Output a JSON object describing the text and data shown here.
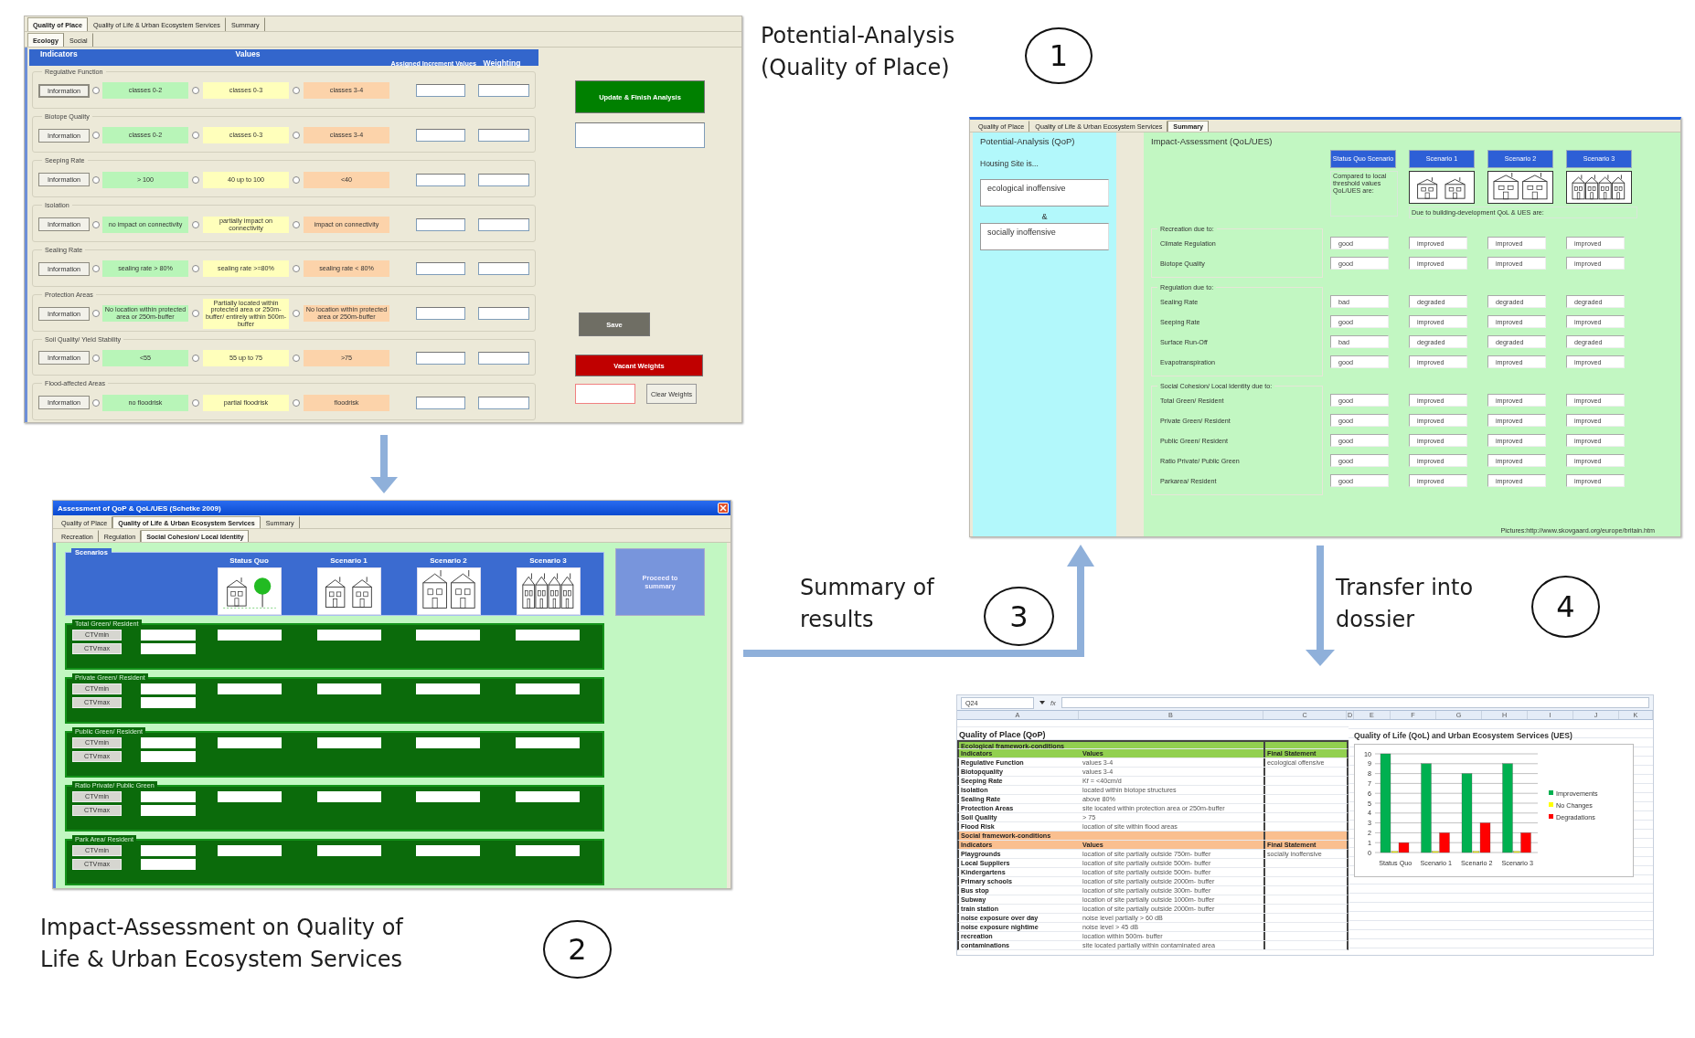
{
  "step_1": {
    "number": "1",
    "caption": [
      "Potential-Analysis",
      "(Quality of Place)"
    ]
  },
  "quality_of_place_window": {
    "tabs": [
      {
        "label": "Quality of Place",
        "selected": true
      },
      {
        "label": "Quality of Life & Urban Ecosystem Services",
        "selected": false
      },
      {
        "label": "Summary",
        "selected": false
      }
    ],
    "subtabs": [
      {
        "label": "Ecology",
        "selected": true
      },
      {
        "label": "Social",
        "selected": false
      }
    ],
    "columns": [
      "Indicators",
      "Values",
      "Assigned Increment Values",
      "Weighting"
    ],
    "indicators": [
      {
        "name": "Regulative Function",
        "button": "Information",
        "options": [
          {
            "text": "classes 0-2",
            "color": "#b8f5b8",
            "selected": false
          },
          {
            "text": "classes 0-3",
            "color": "#ffffbb",
            "selected": false
          },
          {
            "text": "classes 3-4",
            "color": "#fcd3aa",
            "selected": false
          }
        ]
      },
      {
        "name": "Biotope Quality",
        "button": "Information",
        "options": [
          {
            "text": "classes 0-2",
            "color": "#b8f5b8",
            "selected": false
          },
          {
            "text": "classes 0-3",
            "color": "#ffffbb",
            "selected": false
          },
          {
            "text": "classes 3-4",
            "color": "#fcd3aa",
            "selected": false
          }
        ]
      },
      {
        "name": "Seeping Rate",
        "button": "Information",
        "options": [
          {
            "text": "> 100",
            "color": "#b8f5b8",
            "selected": false
          },
          {
            "text": "40 up to 100",
            "color": "#ffffbb",
            "selected": false
          },
          {
            "text": "<40",
            "color": "#fcd3aa",
            "selected": false
          }
        ]
      },
      {
        "name": "Isolation",
        "button": "Information",
        "options": [
          {
            "text": "no impact on connectivity",
            "color": "#b8f5b8",
            "selected": false
          },
          {
            "text": "partially impact on connectivity",
            "color": "#ffffbb",
            "selected": false
          },
          {
            "text": "impact on connectivity",
            "color": "#fcd3aa",
            "selected": false
          }
        ]
      },
      {
        "name": "Sealing Rate",
        "button": "Information",
        "options": [
          {
            "text": "sealing rate > 80%",
            "color": "#b8f5b8",
            "selected": false
          },
          {
            "text": "sealing rate >=80%",
            "color": "#ffffbb",
            "selected": false
          },
          {
            "text": "sealing rate < 80%",
            "color": "#fcd3aa",
            "selected": false
          }
        ]
      },
      {
        "name": "Protection Areas",
        "button": "Information",
        "options": [
          {
            "text": "No location within protected area or 250m-buffer",
            "color": "#b8f5b8",
            "selected": false
          },
          {
            "text": "Partially located within protected area or 250m-buffer/ entirely within 500m-buffer",
            "color": "#ffffbb",
            "selected": false
          },
          {
            "text": "No location within protected area or 250m-buffer",
            "color": "#fcd3aa",
            "selected": false
          }
        ]
      },
      {
        "name": "Soil Quality/ Yield Stability",
        "button": "Information",
        "options": [
          {
            "text": "<55",
            "color": "#b8f5b8",
            "selected": false
          },
          {
            "text": "55 up to 75",
            "color": "#ffffbb",
            "selected": false
          },
          {
            "text": ">75",
            "color": "#fcd3aa",
            "selected": false
          }
        ]
      },
      {
        "name": "Flood-affected Areas",
        "button": "Information",
        "options": [
          {
            "text": "no floodrisk",
            "color": "#b8f5b8",
            "selected": false
          },
          {
            "text": "partial floodrisk",
            "color": "#ffffbb",
            "selected": false
          },
          {
            "text": "floodrisk",
            "color": "#fcd3aa",
            "selected": false
          }
        ]
      }
    ],
    "update_button": "Update & Finish Analysis",
    "save_button": "Save",
    "vacant_weights_button": "Vacant Weights",
    "clear_weights_button": "Clear Weights"
  },
  "step_2": {
    "number": "2",
    "caption": [
      "Impact-Assessment on Quality of",
      "Life & Urban Ecosystem Services"
    ]
  },
  "impact_window": {
    "title": "Assessment of QoP & QoL/UES (Schetke 2009)",
    "tabs": [
      {
        "label": "Quality of Place",
        "selected": false
      },
      {
        "label": "Quality of Life & Urban Ecosystem Services",
        "selected": true
      },
      {
        "label": "Summary",
        "selected": false
      }
    ],
    "subtabs": [
      {
        "label": "Recreation",
        "selected": false
      },
      {
        "label": "Regulation",
        "selected": false
      },
      {
        "label": "Social Cohesion/ Local Identity",
        "selected": true
      }
    ],
    "scenarios_label": "Scenarios",
    "scenarios": [
      {
        "label": "Status Quo",
        "kind": "tree"
      },
      {
        "label": "Scenario 1",
        "kind": "pair"
      },
      {
        "label": "Scenario 2",
        "kind": "blocks"
      },
      {
        "label": "Scenario 3",
        "kind": "terrace"
      }
    ],
    "proceed_button": "Proceed to summary",
    "indicator_groups": [
      {
        "title": "Total Green/ Resident",
        "min_button": "CTVmin",
        "max_button": "CTVmax"
      },
      {
        "title": "Private Green/ Resident",
        "min_button": "CTVmin",
        "max_button": "CTVmax"
      },
      {
        "title": "Public Green/ Resident",
        "min_button": "CTVmin",
        "max_button": "CTVmax"
      },
      {
        "title": "Ratio Private/ Public Green",
        "min_button": "CTVmin",
        "max_button": "CTVmax"
      },
      {
        "title": "Park Area/ Resident",
        "min_button": "CTVmin",
        "max_button": "CTVmax"
      }
    ]
  },
  "step_3": {
    "number": "3",
    "caption": [
      "Summary of",
      "results"
    ]
  },
  "summary_window": {
    "tabs": [
      {
        "label": "Quality of Place",
        "selected": false
      },
      {
        "label": "Quality of Life & Urban Ecosystem Services",
        "selected": false
      },
      {
        "label": "Summary",
        "selected": true
      }
    ],
    "potential": {
      "title": "Potential-Analysis (QoP)",
      "label": "Housing Site is...",
      "ecological": "ecological inoffensive",
      "joiner": "&",
      "social": "socially inoffensive"
    },
    "impact": {
      "title": "Impact-Assessment (QoL/UES)",
      "scenarios": [
        {
          "label": "Status Quo Scenario",
          "kind": "note"
        },
        {
          "label": "Scenario 1",
          "kind": "pair"
        },
        {
          "label": "Scenario 2",
          "kind": "blocks"
        },
        {
          "label": "Scenario 3",
          "kind": "terrace"
        }
      ],
      "threshold_note": "Compared to local threshold values QoL/UES are:",
      "development_note": "Due to building-development QoL & UES are:",
      "groups": [
        {
          "title": "Recreation due to:",
          "rows": [
            {
              "label": "Climate Regulation",
              "values": [
                "good",
                "improved",
                "improved",
                "improved"
              ]
            },
            {
              "label": "Biotope Quality",
              "values": [
                "good",
                "improved",
                "improved",
                "improved"
              ]
            }
          ]
        },
        {
          "title": "Regulation due to:",
          "rows": [
            {
              "label": "Sealing Rate",
              "values": [
                "bad",
                "degraded",
                "degraded",
                "degraded"
              ]
            },
            {
              "label": "Seeping Rate",
              "values": [
                "good",
                "improved",
                "improved",
                "improved"
              ]
            },
            {
              "label": "Surface Run-Off",
              "values": [
                "bad",
                "degraded",
                "degraded",
                "degraded"
              ]
            },
            {
              "label": "Evapotranspiration",
              "values": [
                "good",
                "improved",
                "improved",
                "improved"
              ]
            }
          ]
        },
        {
          "title": "Social Cohesion/ Local Identity due to:",
          "rows": [
            {
              "label": "Total Green/ Resident",
              "values": [
                "good",
                "improved",
                "improved",
                "improved"
              ]
            },
            {
              "label": "Private Green/ Resident",
              "values": [
                "good",
                "improved",
                "improved",
                "improved"
              ]
            },
            {
              "label": "Public Green/ Resident",
              "values": [
                "good",
                "improved",
                "improved",
                "improved"
              ]
            },
            {
              "label": "Ratio Private/ Public Green",
              "values": [
                "good",
                "improved",
                "improved",
                "improved"
              ]
            },
            {
              "label": "Parkarea/ Resident",
              "values": [
                "good",
                "improved",
                "improved",
                "improved"
              ]
            }
          ]
        }
      ],
      "credit": "Pictures:http://www.skovgaard.org/europe/britain.htm"
    }
  },
  "step_4": {
    "number": "4",
    "caption": [
      "Transfer into",
      "dossier"
    ]
  },
  "dossier_sheet": {
    "name_box": "Q24",
    "formula_label": "fx",
    "column_letters": [
      "A",
      "B",
      "C",
      "D",
      "E",
      "F",
      "G",
      "H",
      "I",
      "J",
      "K"
    ],
    "title": "Quality of Place (QoP)",
    "sections": [
      {
        "heading": "Ecological framework-conditions",
        "color": "#92d050",
        "header": [
          "Indicators",
          "Values",
          "Final Statement"
        ],
        "rows": [
          {
            "indicator": "Regulative Function",
            "value": "values 3-4",
            "statement": "ecological offensive"
          },
          {
            "indicator": "Biotopquality",
            "value": "values 3-4"
          },
          {
            "indicator": "Seeping Rate",
            "value": "Kf = <40cm/d"
          },
          {
            "indicator": "Isolation",
            "value": "located within biotope structures"
          },
          {
            "indicator": "Sealing Rate",
            "value": "above 80%"
          },
          {
            "indicator": "Protection Areas",
            "value": "site located within protection area or 250m-buffer"
          },
          {
            "indicator": "Soil Quality",
            "value": "> 75"
          },
          {
            "indicator": "Flood Risk",
            "value": "location of site within flood areas"
          }
        ]
      },
      {
        "heading": "Social framework-conditions",
        "color": "#fabf8f",
        "header": [
          "Indicators",
          "Values",
          "Final Statement"
        ],
        "rows": [
          {
            "indicator": "Playgrounds",
            "value": "location of site partially outside 750m- buffer",
            "statement": "socially inoffensive"
          },
          {
            "indicator": "Local Suppliers",
            "value": "location of site partially outside 500m- buffer"
          },
          {
            "indicator": "Kindergartens",
            "value": "location of site partially outside 500m- buffer"
          },
          {
            "indicator": "Primary schools",
            "value": "location of site partially outside 2000m- buffer"
          },
          {
            "indicator": "Bus stop",
            "value": "location of site partially outside 300m- buffer"
          },
          {
            "indicator": "Subway",
            "value": "location of site partially outside 1000m- buffer"
          },
          {
            "indicator": "train station",
            "value": "location of site partially outside 2000m- buffer"
          },
          {
            "indicator": "noise exposure over day",
            "value": "noise level partially > 60 dB"
          },
          {
            "indicator": "noise exposure nightime",
            "value": "noise level > 45 dB"
          },
          {
            "indicator": "recreation",
            "value": "location within 500m- buffer"
          },
          {
            "indicator": "contaminations",
            "value": "site located partially within contaminated area"
          }
        ]
      }
    ],
    "chart_data": {
      "type": "bar",
      "title": "Quality of Life (QoL) and Urban Ecosystem Services (UES)",
      "categories": [
        "Status Quo",
        "Scenario 1",
        "Scenario 2",
        "Scenario 3"
      ],
      "series": [
        {
          "name": "Improvements",
          "color": "#00b050",
          "values": [
            10,
            9,
            8,
            9
          ]
        },
        {
          "name": "No Changes",
          "color": "#ffff00",
          "values": [
            0,
            0,
            0,
            0
          ]
        },
        {
          "name": "Degradations",
          "color": "#ff0000",
          "values": [
            1,
            2,
            3,
            2
          ]
        }
      ],
      "ylim": [
        0,
        10
      ],
      "yticks": [
        0,
        1,
        2,
        3,
        4,
        5,
        6,
        7,
        8,
        9,
        10
      ],
      "grid": true,
      "legend": "right"
    }
  }
}
